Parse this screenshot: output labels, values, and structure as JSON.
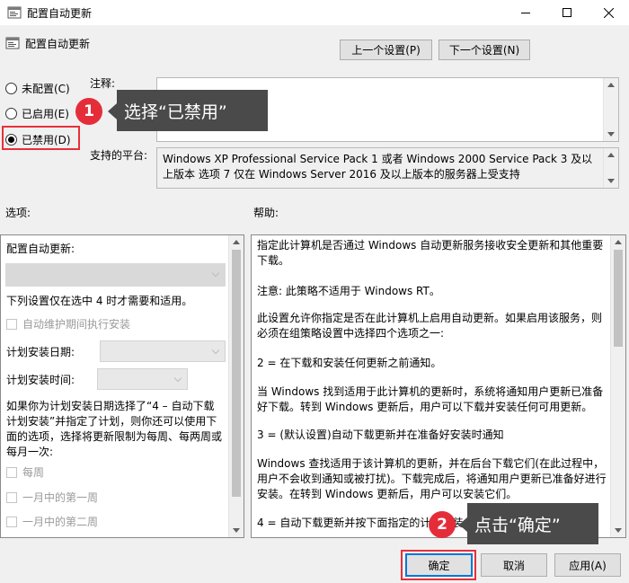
{
  "window": {
    "title": "配置自动更新"
  },
  "header": {
    "title": "配置自动更新",
    "prev_label": "上一个设置(P)",
    "next_label": "下一个设置(N)"
  },
  "states": {
    "not_configured": "未配置(C)",
    "enabled": "已启用(E)",
    "disabled": "已禁用(D)",
    "selected": "disabled"
  },
  "labels": {
    "comment": "注释:",
    "platform": "支持的平台:",
    "options": "选项:",
    "help": "帮助:"
  },
  "platform_text": "Windows XP Professional Service Pack 1 或者 Windows 2000 Service Pack 3 及以上版本 选项 7 仅在 Windows Server 2016 及以上版本的服务器上受支持",
  "options": {
    "heading": "配置自动更新:",
    "note": "下列设置仅在选中 4 时才需要和适用。",
    "maintenance_label": "自动维护期间执行安装",
    "schedule_day_label": "计划安装日期:",
    "schedule_time_label": "计划安装时间:",
    "para_1": "如果你为计划安装日期选择了“4 – 自动下载",
    "para_2": "计划安装”并指定了计划，则你还可以使用下",
    "para_3": "面的选项，选择将更新限制为每周、每两周或",
    "para_4": "每月一次:",
    "weekly_label": "每周",
    "first_week_label": "一月中的第一周",
    "second_week_label": "一月中的第二周"
  },
  "help": {
    "p1": "指定此计算机是否通过 Windows 自动更新服务接收安全更新和其他重要下载。",
    "p2": "注意: 此策略不适用于 Windows RT。",
    "p3": "此设置允许你指定是否在此计算机上启用自动更新。如果启用该服务，则必须在组策略设置中选择四个选项之一:",
    "p4": "2 = 在下载和安装任何更新之前通知。",
    "p5": "当 Windows 找到适用于此计算机的更新时，系统将通知用户更新已准备好下载。转到 Windows 更新后，用户可以下载并安装任何可用更新。",
    "p6": "3 = (默认设置)自动下载更新并在准备好安装时通知",
    "p7": "Windows 查找适用于该计算机的更新，并在后台下载它们(在此过程中，用户不会收到通知或被打扰)。下载完成后，将通知用户更新已准备好进行安装。在转到 Windows 更新后，用户可以安装它们。",
    "p8": "4 = 自动下载更新并按下面指定的计划安装"
  },
  "footer": {
    "ok_label": "确定",
    "cancel_label": "取消",
    "apply_label": "应用(A)"
  },
  "callouts": {
    "step1_number": "1",
    "step1_text": "选择“已禁用”",
    "step2_number": "2",
    "step2_text": "点击“确定”"
  },
  "colors": {
    "accent_red": "#e52d3a",
    "tooltip_bg": "#4a4a4a",
    "focus_blue": "#0078d7"
  }
}
